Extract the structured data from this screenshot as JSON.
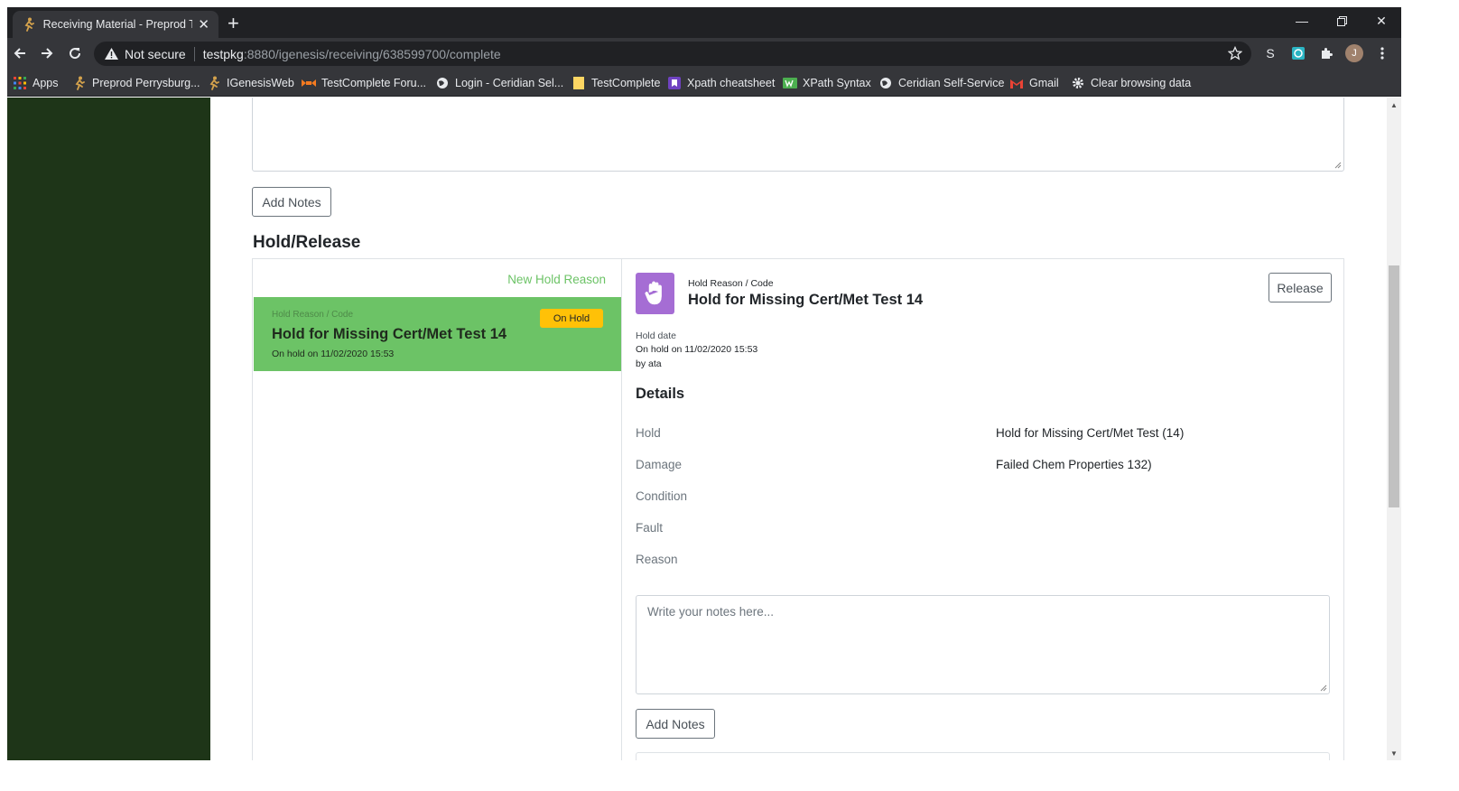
{
  "browser": {
    "tab_title": "Receiving Material - Preprod Tipp",
    "new_tab": "+",
    "url_security": "Not secure",
    "url_host": "testpkg",
    "url_path": ":8880/igenesis/receiving/638599700/complete",
    "profile_initial": "J",
    "extension_s": "S",
    "bookmarks": [
      {
        "label": "Apps",
        "icon": "apps-grid-icon"
      },
      {
        "label": "Preprod Perrysburg...",
        "icon": "runner-icon"
      },
      {
        "label": "IGenesisWeb",
        "icon": "runner-icon"
      },
      {
        "label": "TestComplete Foru...",
        "icon": "testcomplete-icon"
      },
      {
        "label": "Login - Ceridian Sel...",
        "icon": "globe-icon"
      },
      {
        "label": "TestComplete",
        "icon": "folder-icon"
      },
      {
        "label": "Xpath cheatsheet",
        "icon": "bookmark-icon"
      },
      {
        "label": "XPath Syntax",
        "icon": "w3-icon"
      },
      {
        "label": "Ceridian Self-Service",
        "icon": "globe-icon"
      },
      {
        "label": "Gmail",
        "icon": "gmail-icon"
      },
      {
        "label": "Clear browsing data",
        "icon": "gear-icon"
      }
    ]
  },
  "page": {
    "add_notes_top": "Add Notes",
    "section_title": "Hold/Release",
    "new_hold_reason": "New Hold Reason",
    "hold_item": {
      "label": "Hold Reason / Code",
      "name": "Hold for Missing Cert/Met Test 14",
      "date": "On hold on 11/02/2020 15:53",
      "badge": "On Hold"
    },
    "detail": {
      "label": "Hold Reason / Code",
      "name": "Hold for Missing Cert/Met Test 14",
      "release_button": "Release",
      "hold_date_label": "Hold date",
      "hold_date_value": "On hold on 11/02/2020 15:53",
      "hold_by": "by ata",
      "details_heading": "Details",
      "rows": [
        {
          "label": "Hold",
          "value": "Hold for Missing Cert/Met Test (14)"
        },
        {
          "label": "Damage",
          "value": "Failed Chem Properties 132)"
        },
        {
          "label": "Condition",
          "value": ""
        },
        {
          "label": "Fault",
          "value": ""
        },
        {
          "label": "Reason",
          "value": ""
        }
      ],
      "notes_placeholder": "Write your notes here...",
      "add_notes": "Add Notes"
    }
  },
  "colors": {
    "sidebar": "#1e3518",
    "hold_green": "#6cc366",
    "badge_yellow": "#ffc107",
    "hand_purple": "#a56dd4"
  }
}
